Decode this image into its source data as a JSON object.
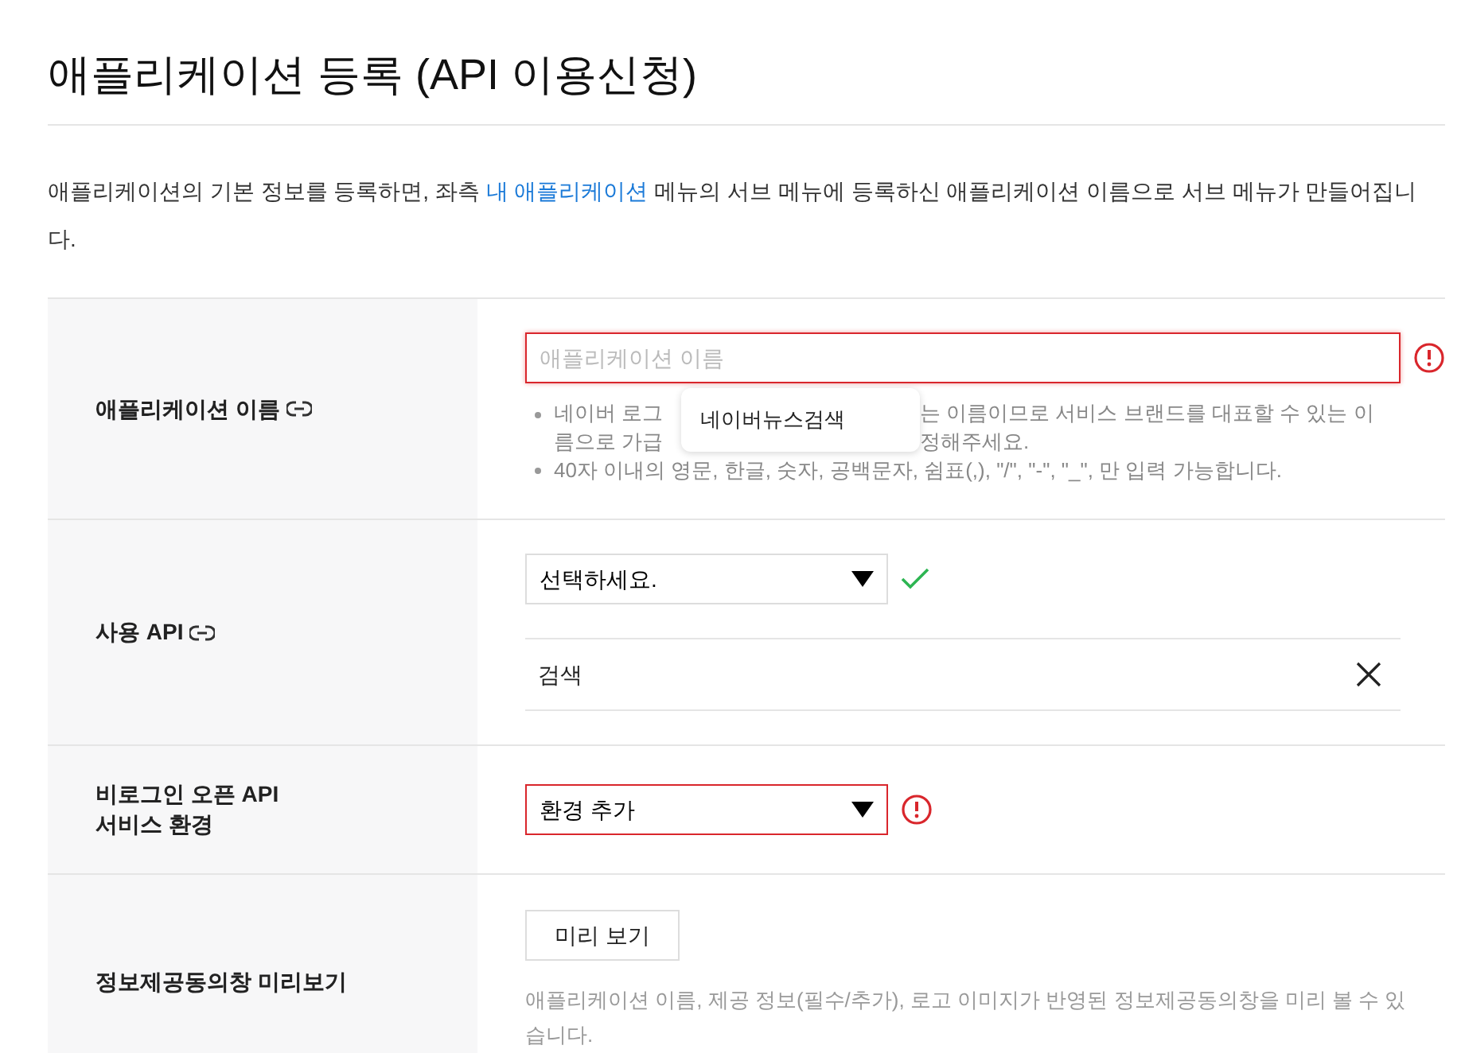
{
  "title": "애플리케이션 등록 (API 이용신청)",
  "description": {
    "before": "애플리케이션의 기본 정보를 등록하면, 좌측 ",
    "link": "내 애플리케이션",
    "after": " 메뉴의 서브 메뉴에 등록하신 애플리케이션 이름으로 서브 메뉴가 만들어집니다."
  },
  "rows": [
    {
      "kind": "name",
      "label": "애플리케이션 이름",
      "link_icon": true,
      "field": {
        "placeholder": "애플리케이션 이름",
        "error": true
      },
      "suggestion": "네이버뉴스검색",
      "notes_covered": [
        [
          "네이버 로그",
          "는 이름이므로 서비스 브랜드를 대표할 수 있는 이"
        ],
        [
          "름으로 가급",
          "정해주세요."
        ]
      ],
      "notes": [
        "40자 이내의 영문, 한글, 숫자, 공백문자, 쉼표(,), \"/\", \"-\", \"_\", 만 입력 가능합니다."
      ]
    },
    {
      "kind": "api",
      "label": "사용 API",
      "link_icon": true,
      "select": {
        "value": "선택하세요.",
        "valid": true
      },
      "chosen": [
        "검색"
      ]
    },
    {
      "kind": "env",
      "label": "비로그인 오픈 API\n서비스 환경",
      "link_icon": false,
      "select": {
        "value": "환경 추가",
        "error": true
      }
    },
    {
      "kind": "preview",
      "label": "정보제공동의창 미리보기",
      "link_icon": false,
      "button": "미리 보기",
      "note": "애플리케이션 이름, 제공 정보(필수/추가), 로고 이미지가 반영된 정보제공동의창을 미리 볼 수 있습니다."
    }
  ]
}
